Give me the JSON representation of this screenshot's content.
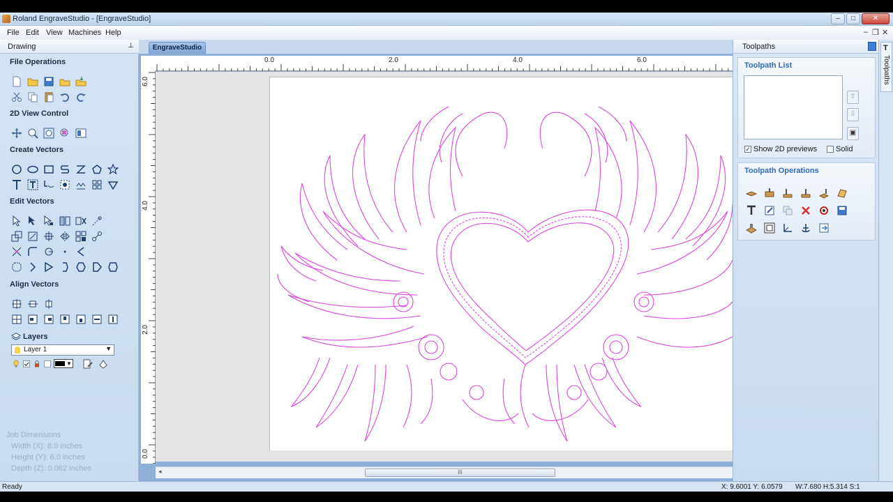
{
  "window": {
    "title": "Roland EngraveStudio - [EngraveStudio]",
    "buttons": [
      "–",
      "□",
      "✕"
    ],
    "mdi_buttons": [
      "–",
      "❐",
      "✕"
    ]
  },
  "menu": [
    "File",
    "Edit",
    "View",
    "Machines",
    "Help"
  ],
  "drawing_panel": {
    "title": "Drawing",
    "pin": "⊥",
    "sections": {
      "file_operations": "File Operations",
      "view_control": "2D View Control",
      "create_vectors": "Create Vectors",
      "edit_vectors": "Edit Vectors",
      "align_vectors": "Align Vectors",
      "layers": "Layers"
    },
    "layer_selected": "Layer 1",
    "job_dimensions": {
      "title": "Job Dimensions",
      "width": "Width  (X): 8.0 inches",
      "height": "Height (Y): 6.0 inches",
      "depth": "Depth  (Z): 0.062 inches"
    }
  },
  "document": {
    "tab": "EngraveStudio",
    "ruler_top": [
      "0.0",
      "2.0",
      "4.0",
      "6.0"
    ],
    "ruler_left": [
      "6.0",
      "4.0",
      "2.0",
      "0.0"
    ],
    "scroll_grip": "III",
    "scroll_left": "◂"
  },
  "toolpaths_panel": {
    "title": "Toolpaths",
    "list_title": "Toolpath List",
    "show_previews": "Show 2D previews",
    "show_previews_checked": true,
    "solid": "Solid",
    "solid_checked": false,
    "operations_title": "Toolpath Operations"
  },
  "side_tab": {
    "icon": "T",
    "label": "Toolpaths"
  },
  "status": {
    "left": "Ready",
    "coords": "X: 9.6001 Y: 6.0579",
    "size": "W:7.680  H:5.314  S:1"
  },
  "colors": {
    "vector": "#dd44dd",
    "accent": "#2f6bb7",
    "panel": "#c9dbef"
  }
}
